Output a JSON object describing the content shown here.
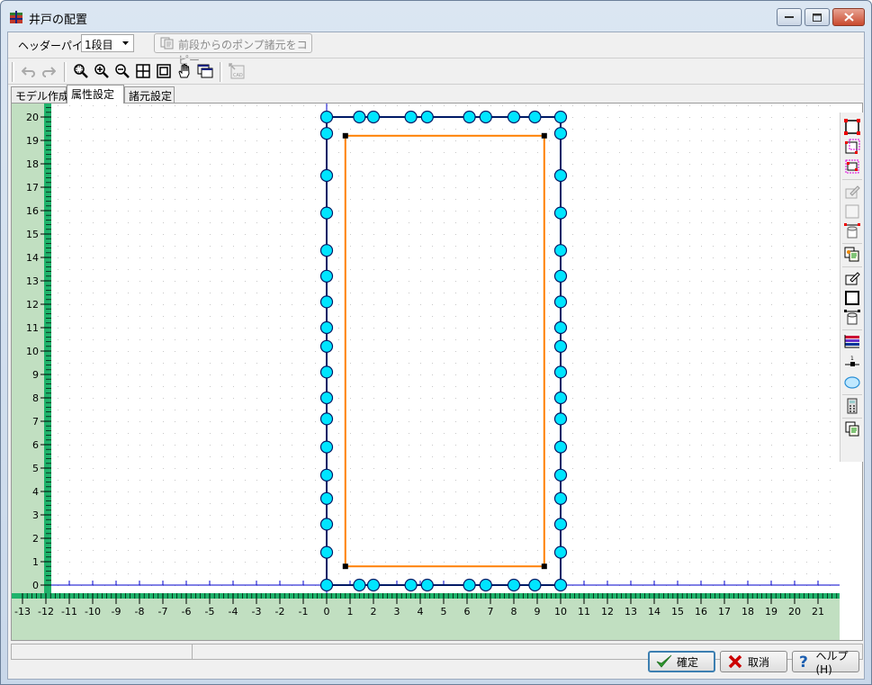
{
  "window": {
    "title": "井戸の配置"
  },
  "toolbar": {
    "header_pipe_label": "ヘッダーパイプ",
    "stage_value": "1段目",
    "copy_button_label": "前段からのポンプ諸元をコピー"
  },
  "tabs": [
    {
      "label": "モデル作成"
    },
    {
      "label": "属性設定"
    },
    {
      "label": "諸元設定"
    }
  ],
  "canvas": {
    "x_ticks": [
      -13,
      -12,
      -11,
      -10,
      -9,
      -8,
      -7,
      -6,
      -5,
      -4,
      -3,
      -2,
      -1,
      0,
      1,
      2,
      3,
      4,
      5,
      6,
      7,
      8,
      9,
      10,
      11,
      12,
      13,
      14,
      15,
      16,
      17,
      18,
      19,
      20,
      21
    ],
    "y_ticks": [
      0,
      1,
      2,
      3,
      4,
      5,
      6,
      7,
      8,
      9,
      10,
      11,
      12,
      13,
      14,
      15,
      16,
      17,
      18,
      19,
      20
    ],
    "area": {
      "x": [
        0,
        10
      ],
      "y": [
        0,
        20
      ]
    },
    "pipe": {
      "x": [
        0.8,
        9.3
      ],
      "y": [
        0.8,
        19.2
      ]
    },
    "wells_top_bottom_x": [
      0,
      1.4,
      2.0,
      3.6,
      4.3,
      6.1,
      6.8,
      8.0,
      8.9,
      10
    ],
    "wells_side_y": [
      0,
      1.4,
      2.6,
      3.7,
      4.7,
      5.9,
      7.1,
      8.0,
      9.1,
      10.2,
      11.0,
      12.1,
      13.2,
      14.3,
      15.9,
      17.5,
      19.3,
      20
    ],
    "colors": {
      "axis": "#0000cc",
      "area_border": "#001a66",
      "pipe": "#ff8000",
      "well_fill": "#00e5ff",
      "ruler_bg": "#c1dfc1"
    }
  },
  "buttons": {
    "ok_label": "確定",
    "cancel_label": "取消",
    "help_label": "ヘルプ(H)"
  }
}
